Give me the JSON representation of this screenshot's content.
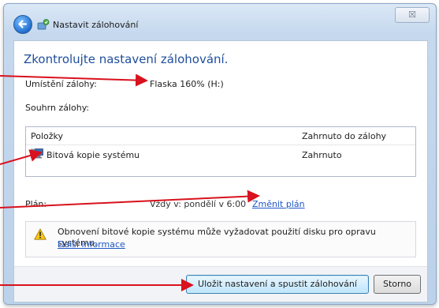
{
  "window": {
    "title": "Nastavit zálohování",
    "close_glyph": "☒"
  },
  "heading": "Zkontrolujte nastavení zálohování.",
  "location": {
    "label": "Umístění zálohy:",
    "value": "Flaska 160% (H:)"
  },
  "scope": {
    "label": "Souhrn zálohy:"
  },
  "list": {
    "columns": [
      "Položky",
      "Zahrnuto do zálohy"
    ],
    "rows": [
      {
        "name": "Bitová kopie systému",
        "status": "Zahrnuto",
        "icon": "computer-icon"
      }
    ]
  },
  "schedule": {
    "label": "Plán:",
    "value": "Vždy v: pondělí v 6:00",
    "link": "Změnit plán"
  },
  "info": {
    "icon": "warning-icon",
    "text": "Obnovení bitové kopie systému může vyžadovat použití disku pro opravu systému.",
    "link": "Další informace"
  },
  "buttons": {
    "primary": "Uložit nastavení a spustit zálohování",
    "cancel": "Storno"
  },
  "colors": {
    "accent": "#1f4e9c",
    "link": "#1f56c4",
    "annotation": "#d8121e"
  }
}
